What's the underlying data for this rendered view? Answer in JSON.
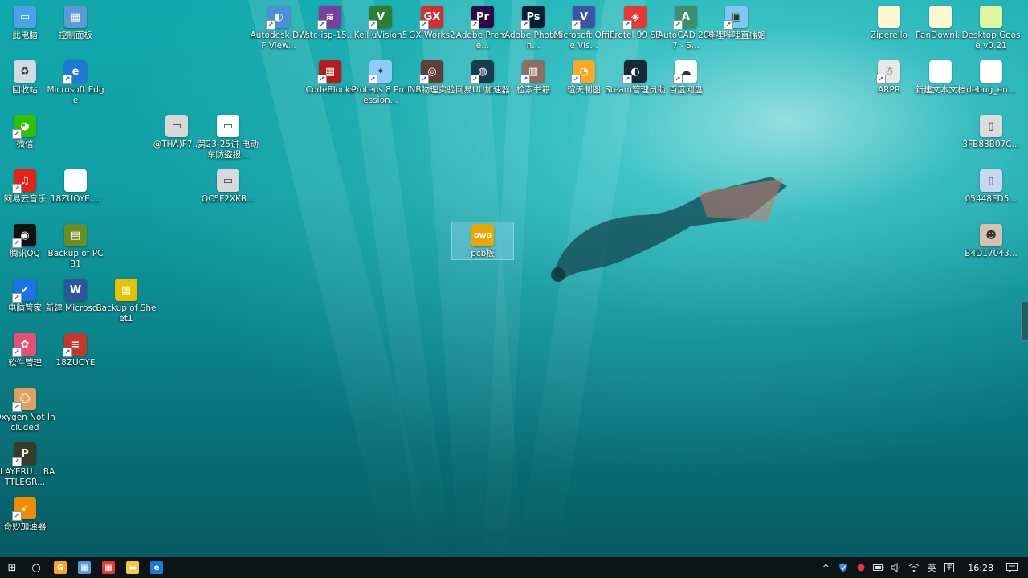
{
  "desktop": {
    "icons": [
      {
        "id": "this-pc",
        "label": "此电脑",
        "icon": "computer-icon",
        "color": "#4aa3e8",
        "sym": "▭",
        "shortcut": false
      },
      {
        "id": "control-panel",
        "label": "控制面板",
        "icon": "control-panel-icon",
        "color": "#5b9bd5",
        "sym": "▦",
        "shortcut": false
      },
      {
        "id": "recycle-bin",
        "label": "回收站",
        "icon": "recycle-bin-icon",
        "color": "#d0dbe6",
        "sym": "♻",
        "shortcut": false
      },
      {
        "id": "edge",
        "label": "Microsoft Edge",
        "icon": "edge-icon",
        "color": "#1e78d6",
        "sym": "e",
        "shortcut": true
      },
      {
        "id": "wechat",
        "label": "微信",
        "icon": "wechat-icon",
        "color": "#2dc100",
        "sym": "◕",
        "shortcut": true
      },
      {
        "id": "netease-music",
        "label": "网易云音乐",
        "icon": "netease-music-icon",
        "color": "#e2231a",
        "sym": "♫",
        "shortcut": true
      },
      {
        "id": "18zuoye-file",
        "label": "18ZUOYE....",
        "icon": "document-icon",
        "color": "#ffffff",
        "sym": "",
        "shortcut": false
      },
      {
        "id": "qq",
        "label": "腾讯QQ",
        "icon": "qq-icon",
        "color": "#111111",
        "sym": "◉",
        "shortcut": true
      },
      {
        "id": "backup-pcb1",
        "label": "Backup of PCB1",
        "icon": "pcb-file-icon",
        "color": "#6b8e23",
        "sym": "▤",
        "shortcut": false
      },
      {
        "id": "pc-manager",
        "label": "电脑管家",
        "icon": "shield-icon",
        "color": "#1a73e8",
        "sym": "✔",
        "shortcut": true
      },
      {
        "id": "new-word",
        "label": "新建 Microso...",
        "icon": "word-document-icon",
        "color": "#2b579a",
        "sym": "W",
        "shortcut": false
      },
      {
        "id": "backup-sheet1",
        "label": "Backup of Sheet1",
        "icon": "schematic-file-icon",
        "color": "#e5c100",
        "sym": "▦",
        "shortcut": false
      },
      {
        "id": "software-manager",
        "label": "软件管理",
        "icon": "software-manager-icon",
        "color": "#e94e77",
        "sym": "✿",
        "shortcut": true
      },
      {
        "id": "18zuoye",
        "label": "18ZUOYE",
        "icon": "project-file-icon",
        "color": "#c0392b",
        "sym": "≡",
        "shortcut": true
      },
      {
        "id": "oxygen",
        "label": "Oxygen Not Included",
        "icon": "game-icon",
        "color": "#e0a060",
        "sym": "☺",
        "shortcut": true
      },
      {
        "id": "pubg",
        "label": "PLAYERU... BATTLEGR...",
        "icon": "pubg-icon",
        "color": "#3a3a2a",
        "sym": "P",
        "shortcut": true
      },
      {
        "id": "qimiao",
        "label": "奇妙加速器",
        "icon": "accelerator-icon",
        "color": "#f08c00",
        "sym": "➶",
        "shortcut": true
      },
      {
        "id": "thaf7",
        "label": "@THA)F7...",
        "icon": "image-file-icon",
        "color": "#d8d8d8",
        "sym": "▭",
        "shortcut": false
      },
      {
        "id": "lecture23",
        "label": "第23-25讲 电动车防盗报...",
        "icon": "image-file-icon",
        "color": "#ffffff",
        "sym": "▭",
        "shortcut": false
      },
      {
        "id": "qc5f2xkb",
        "label": "QC5F2XKB...",
        "icon": "image-file-icon",
        "color": "#d8d8d8",
        "sym": "▭",
        "shortcut": false
      },
      {
        "id": "autodesk-dwf",
        "label": "Autodesk DWF View...",
        "icon": "autodesk-icon",
        "color": "#4a90d9",
        "sym": "◐",
        "shortcut": true
      },
      {
        "id": "stc-isp",
        "label": "stc-isp-15...",
        "icon": "stc-isp-icon",
        "color": "#7b3fa0",
        "sym": "≋",
        "shortcut": true
      },
      {
        "id": "keil",
        "label": "Keil uVision5",
        "icon": "keil-icon",
        "color": "#2e7d32",
        "sym": "V",
        "shortcut": true
      },
      {
        "id": "gx-works2",
        "label": "GX Works2",
        "icon": "gx-works-icon",
        "color": "#d32f2f",
        "sym": "GX",
        "shortcut": true
      },
      {
        "id": "premiere",
        "label": "Adobe Premie...",
        "icon": "premiere-icon",
        "color": "#2a0a47",
        "sym": "Pr",
        "shortcut": true
      },
      {
        "id": "photoshop",
        "label": "Adobe Photosh...",
        "icon": "photoshop-icon",
        "color": "#001e36",
        "sym": "Ps",
        "shortcut": true
      },
      {
        "id": "office-visio",
        "label": "Microsoft Office Vis...",
        "icon": "visio-icon",
        "color": "#3955a3",
        "sym": "V",
        "shortcut": true
      },
      {
        "id": "protel99",
        "label": "Protel 99 SE",
        "icon": "protel-icon",
        "color": "#e53935",
        "sym": "◈",
        "shortcut": true
      },
      {
        "id": "autocad",
        "label": "AutoCAD 2007 - S...",
        "icon": "autocad-icon",
        "color": "#3d8f6b",
        "sym": "A",
        "shortcut": true
      },
      {
        "id": "bili-live",
        "label": "哔哩哔哩直播姬",
        "icon": "bilibili-live-icon",
        "color": "#7fc8f0",
        "sym": "▣",
        "shortcut": true
      },
      {
        "id": "codeblocks",
        "label": "CodeBlocks",
        "icon": "codeblocks-icon",
        "color": "#b71c1c",
        "sym": "▦",
        "shortcut": true
      },
      {
        "id": "proteus",
        "label": "Proteus 8 Profession...",
        "icon": "proteus-icon",
        "color": "#90caf9",
        "sym": "✦",
        "shortcut": true
      },
      {
        "id": "nb-lab",
        "label": "NB物理实验",
        "icon": "nb-lab-icon",
        "color": "#5d4037",
        "sym": "◎",
        "shortcut": true
      },
      {
        "id": "uu-booster",
        "label": "网易UU加速器",
        "icon": "uu-booster-icon",
        "color": "#1b3a4b",
        "sym": "◍",
        "shortcut": true
      },
      {
        "id": "book-search",
        "label": "检索书籍",
        "icon": "books-icon",
        "color": "#8d6e63",
        "sym": "▥",
        "shortcut": true
      },
      {
        "id": "tianyu",
        "label": "瑄天制图",
        "icon": "drawing-icon",
        "color": "#f9a825",
        "sym": "◔",
        "shortcut": true
      },
      {
        "id": "steam-manager",
        "label": "Steam管理员助",
        "icon": "steam-icon",
        "color": "#1b2838",
        "sym": "◐",
        "shortcut": true
      },
      {
        "id": "baidu-pan",
        "label": "百度网盘",
        "icon": "cloud-drive-icon",
        "color": "#ffffff",
        "sym": "☁",
        "shortcut": true
      },
      {
        "id": "ziperello",
        "label": "Ziperello",
        "icon": "document-icon",
        "color": "#fff8d0",
        "sym": "",
        "shortcut": false
      },
      {
        "id": "pandownload",
        "label": "PanDownl...",
        "icon": "document-icon",
        "color": "#fff8d0",
        "sym": "",
        "shortcut": false
      },
      {
        "id": "desktop-goose",
        "label": "Desktop Goose v0.21",
        "icon": "document-icon",
        "color": "#dff5a0",
        "sym": "",
        "shortcut": false
      },
      {
        "id": "arpr",
        "label": "ARPR",
        "icon": "arpr-icon",
        "color": "#e8e8e8",
        "sym": "☃",
        "shortcut": true
      },
      {
        "id": "new-text",
        "label": "新建文本文档",
        "icon": "text-file-icon",
        "color": "#ffffff",
        "sym": "",
        "shortcut": false
      },
      {
        "id": "debug-en",
        "label": "debug_en...",
        "icon": "text-file-icon",
        "color": "#ffffff",
        "sym": "",
        "shortcut": false
      },
      {
        "id": "3fb88b07",
        "label": "3FB88B07C...",
        "icon": "phone-image-icon",
        "color": "#dcdcdc",
        "sym": "▯",
        "shortcut": false
      },
      {
        "id": "05448ed5",
        "label": "05448ED5...",
        "icon": "phone-image-icon",
        "color": "#c9d8f0",
        "sym": "▯",
        "shortcut": false
      },
      {
        "id": "b4d17043",
        "label": "B4D17043...",
        "icon": "photo-icon",
        "color": "#d8c0b0",
        "sym": "☻",
        "shortcut": false
      },
      {
        "id": "pcb-dwg",
        "label": "pcb板",
        "icon": "dwg-file-icon",
        "color": "#e9a500",
        "sym": "DWG",
        "shortcut": false,
        "selected": true
      }
    ]
  },
  "taskbar": {
    "start_icon": "⊞",
    "cortana_icon": "○",
    "apps": [
      {
        "id": "app-g",
        "icon": "g-app-icon",
        "sym": "G",
        "color": "#f5a623"
      },
      {
        "id": "app-control",
        "icon": "control-panel-icon",
        "sym": "▦",
        "color": "#5b9bd5"
      },
      {
        "id": "app-colorful",
        "icon": "colorful-app-icon",
        "sym": "▦",
        "color": "#e53935"
      },
      {
        "id": "app-explorer",
        "icon": "folder-icon",
        "sym": "▬",
        "color": "#f2c94c"
      },
      {
        "id": "app-edge",
        "icon": "edge-icon",
        "sym": "e",
        "color": "#1e78d6"
      }
    ],
    "tray": {
      "chevron": "^",
      "ime": "英",
      "time": "16:28",
      "icons": [
        "shield-icon",
        "red-app-icon",
        "battery-icon",
        "speaker-icon",
        "wifi-icon"
      ]
    }
  }
}
